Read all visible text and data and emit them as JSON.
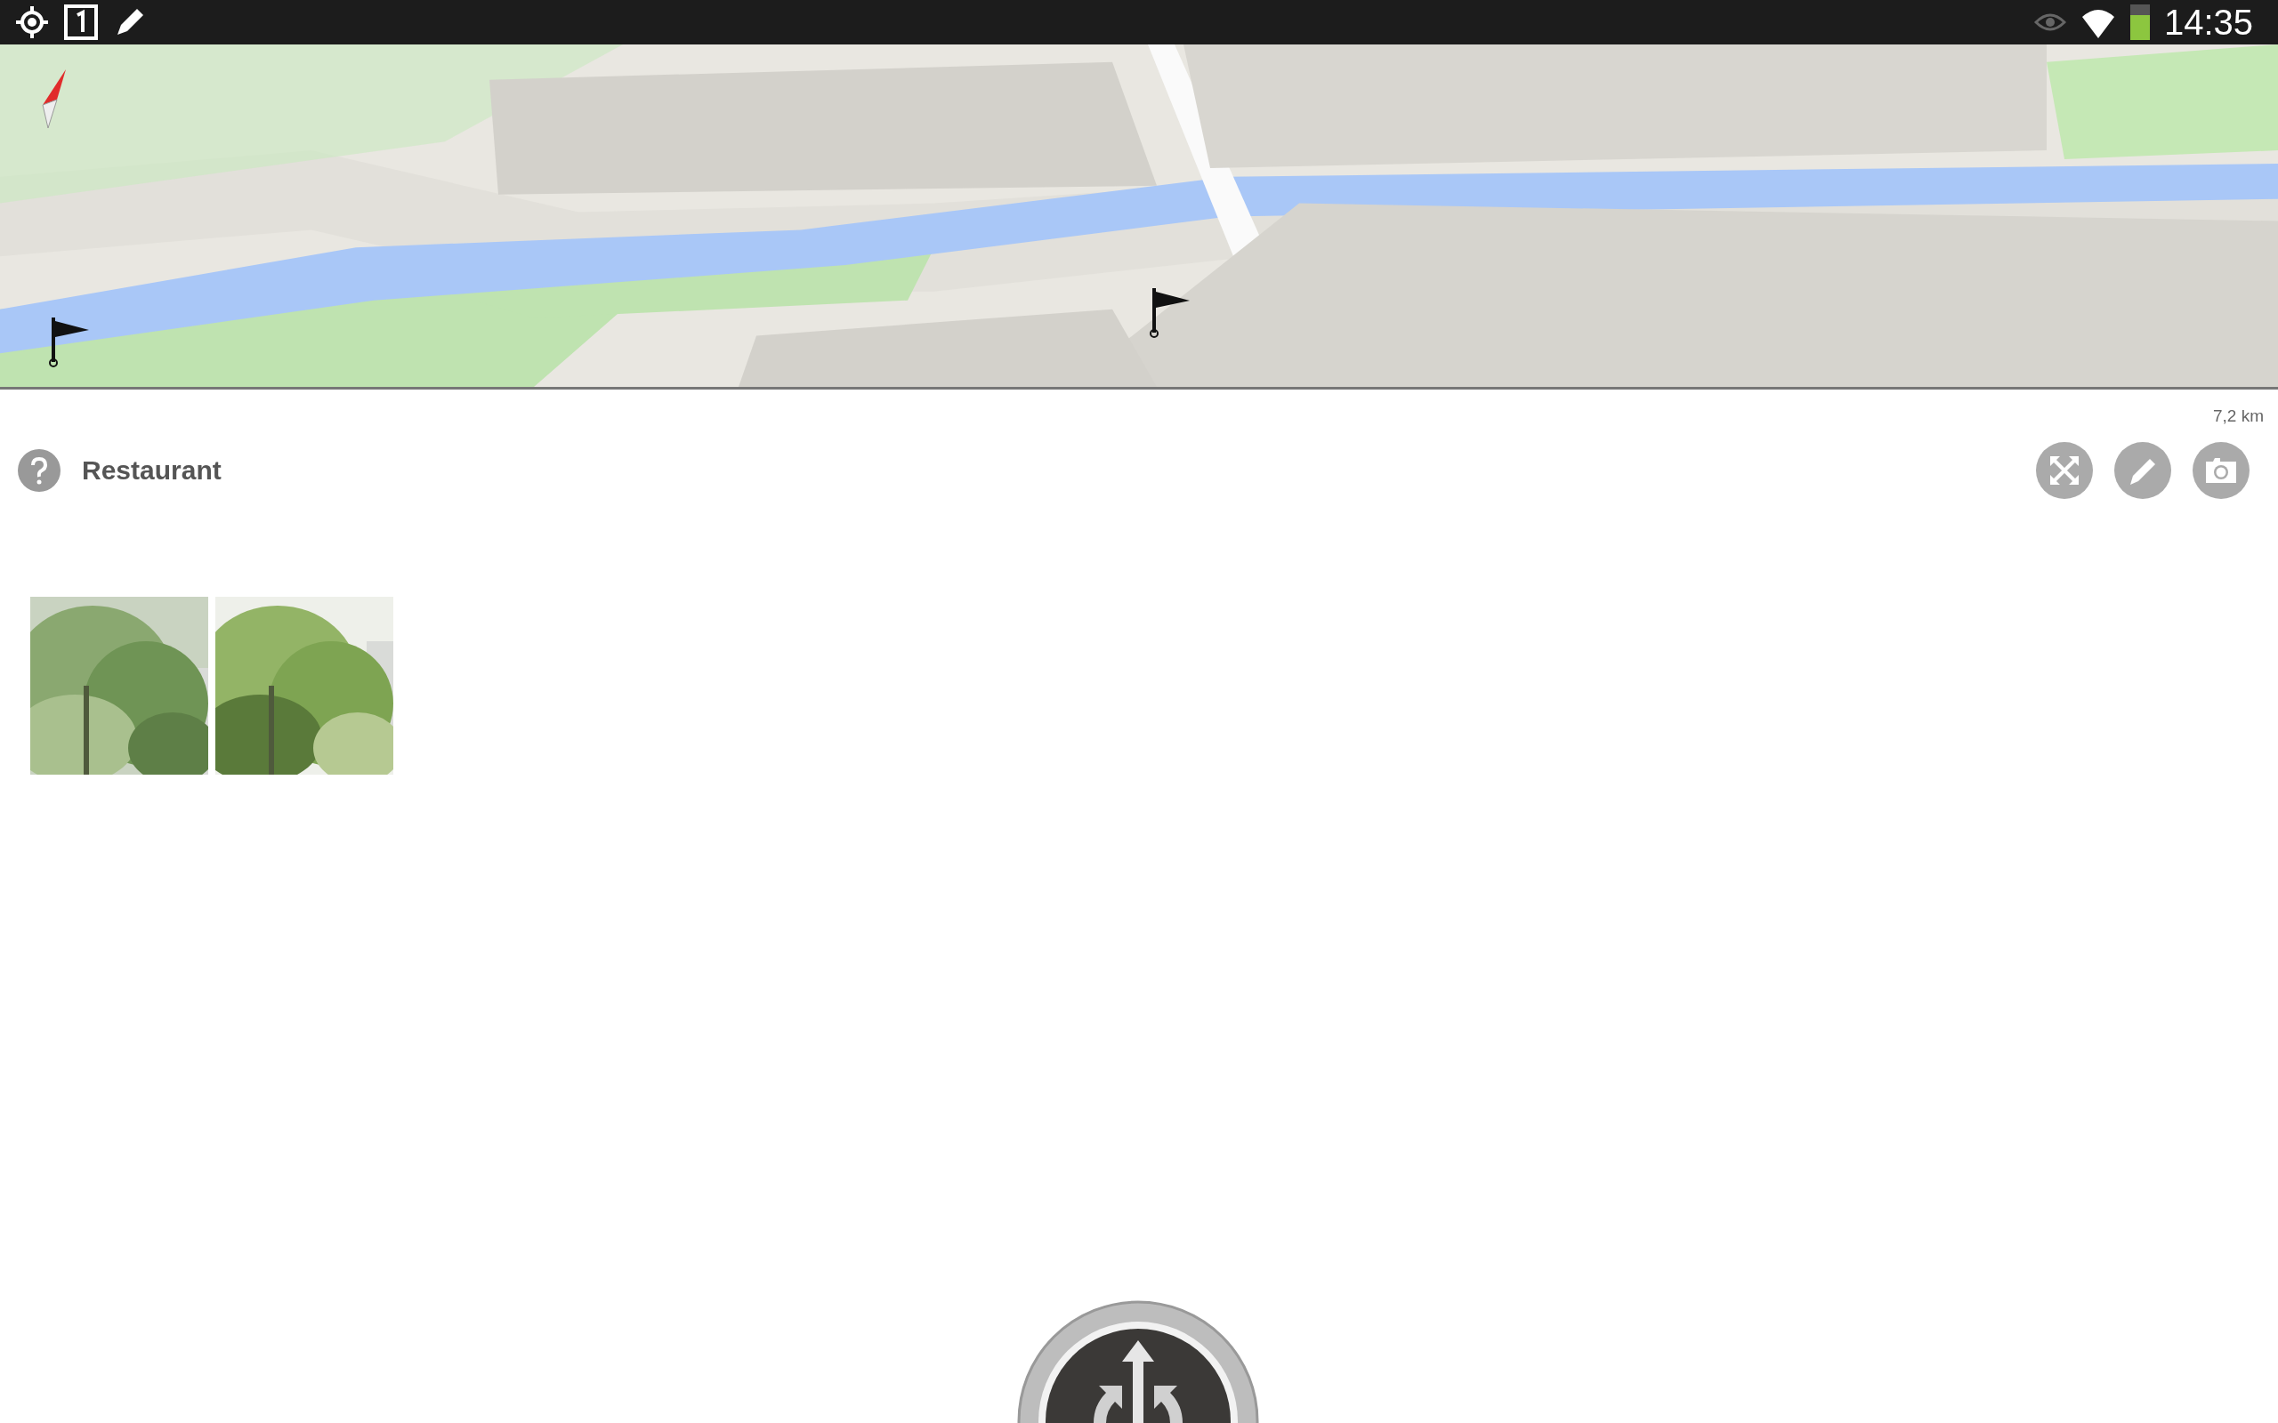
{
  "status_bar": {
    "time": "14:35"
  },
  "map": {
    "kind": "picture",
    "scale": "7,2 km"
  },
  "place": {
    "title": "Restaurant"
  }
}
